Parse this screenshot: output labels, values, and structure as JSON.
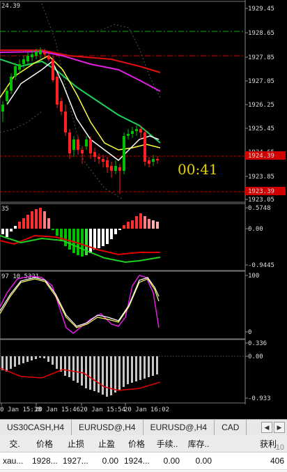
{
  "main": {
    "corner_label": "24.39",
    "price_axis": [
      "1929.45",
      "1928.65",
      "1927.85",
      "1927.05",
      "1926.25",
      "1925.45",
      "1924.65",
      "1923.85",
      "1923.05"
    ],
    "current_price": "1924.39",
    "lower_price_tag": "1923.39",
    "timer": "00:41",
    "colors": {
      "bull": "#00c000",
      "bear": "#ff2020",
      "ma_yellow": "#ffff40",
      "ma_white": "#ffffff",
      "ma_green": "#20d060",
      "ma_red": "#e01010",
      "ma_magenta": "#e020e0",
      "hline_green": "#00b000",
      "hline_red": "#d00000",
      "timer": "#e8d000"
    }
  },
  "histogram": {
    "label": "35",
    "axis": [
      "0.5748",
      "0.00",
      "-0.9445"
    ]
  },
  "stoch": {
    "label": "97 10.5321",
    "axis": [
      "100",
      "0"
    ]
  },
  "lower_ind": {
    "axis": [
      "0.336",
      "0.00",
      "-0.933"
    ]
  },
  "time_axis": [
    "0 Jan 15:38",
    "20 Jan 15:46",
    "20 Jan 15:54",
    "20 Jan 16:02"
  ],
  "tabs": [
    "US30CASH,H4",
    "EURUSD@,H4",
    "EURUSD@,H4",
    "CAD"
  ],
  "table": {
    "headers": [
      "交.",
      "价格",
      "止损",
      "止盈",
      "价格",
      "手续..",
      "库存..",
      "",
      "获利"
    ],
    "row": [
      "xau...",
      "1928...",
      "1927...",
      "0.00",
      "1924...",
      "0.00",
      "0.00",
      "",
      "406"
    ]
  },
  "watermark": "10"
}
